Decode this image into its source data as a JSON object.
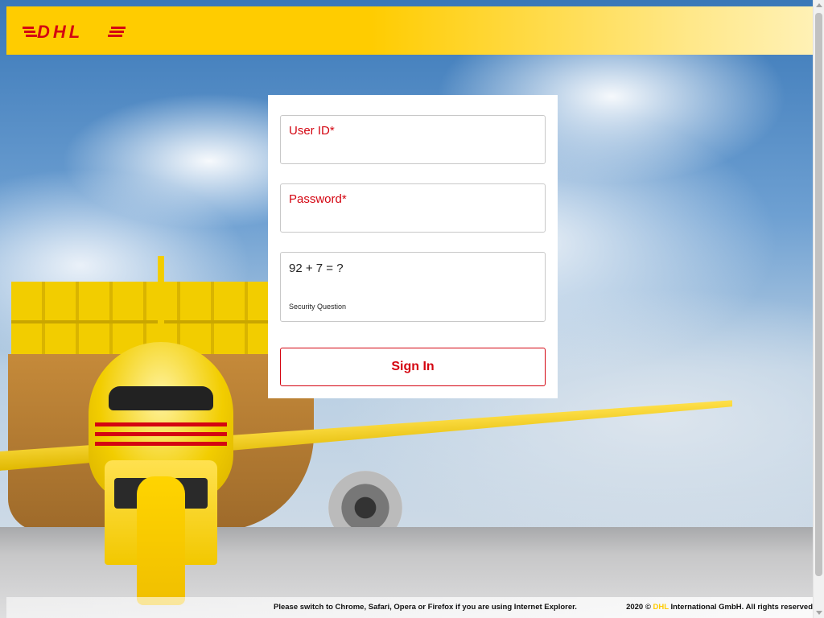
{
  "brand": {
    "logo_text": "DHL",
    "logo_icon": "dhl-logo",
    "primary_color": "#ffcc00",
    "accent_color": "#d40511"
  },
  "login": {
    "user_id_label": "User ID*",
    "password_label": "Password*",
    "security_question": "92 + 7 = ?",
    "security_hint": "Security Question",
    "sign_in_label": "Sign In"
  },
  "footer": {
    "browser_notice": "Please switch to Chrome, Safari, Opera or Firefox if you are using Internet Explorer.",
    "copyright_prefix": "2020 ©",
    "copyright_brand": "DHL",
    "copyright_suffix": "International GmbH. All rights reserved"
  }
}
